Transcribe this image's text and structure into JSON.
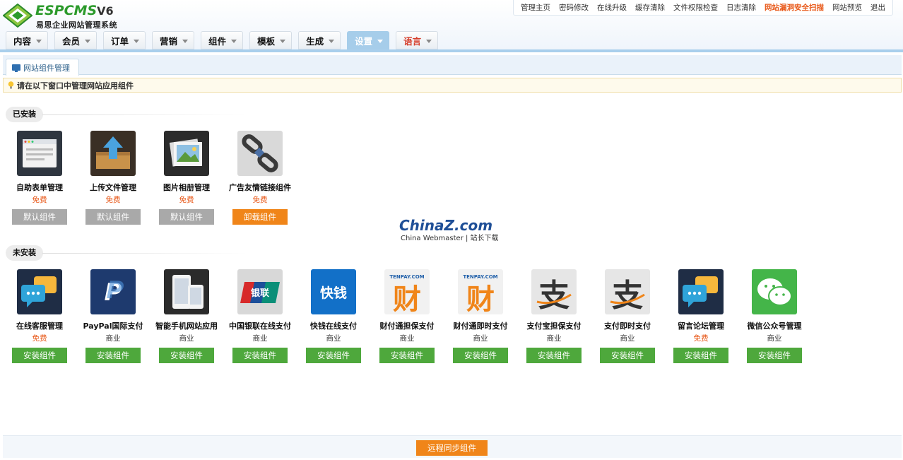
{
  "header": {
    "logo": {
      "brand": "ESPCMS",
      "version": "V6",
      "subtitle": "易思企业网站管理系统"
    },
    "top_links": [
      {
        "label": "管理主页",
        "highlight": false
      },
      {
        "label": "密码修改",
        "highlight": false
      },
      {
        "label": "在线升级",
        "highlight": false
      },
      {
        "label": "缓存清除",
        "highlight": false
      },
      {
        "label": "文件权限检查",
        "highlight": false
      },
      {
        "label": "日志清除",
        "highlight": false
      },
      {
        "label": "网站漏洞安全扫描",
        "highlight": true
      },
      {
        "label": "网站预览",
        "highlight": false
      },
      {
        "label": "退出",
        "highlight": false
      }
    ],
    "nav": [
      {
        "label": "内容",
        "active": false
      },
      {
        "label": "会员",
        "active": false
      },
      {
        "label": "订单",
        "active": false
      },
      {
        "label": "营销",
        "active": false
      },
      {
        "label": "组件",
        "active": false
      },
      {
        "label": "模板",
        "active": false
      },
      {
        "label": "生成",
        "active": false
      },
      {
        "label": "设置",
        "active": true
      },
      {
        "label": "语言",
        "active": false
      }
    ]
  },
  "tab": {
    "label": "网站组件管理"
  },
  "tip": "请在以下窗口中管理网站应用组件",
  "installed": {
    "title": "已安装",
    "items": [
      {
        "name": "自助表单管理",
        "price": "免费",
        "free": true,
        "button": "默认组件",
        "button_style": "gray",
        "icon": "form-icon"
      },
      {
        "name": "上传文件管理",
        "price": "免费",
        "free": true,
        "button": "默认组件",
        "button_style": "gray",
        "icon": "upload-icon"
      },
      {
        "name": "图片相册管理",
        "price": "免费",
        "free": true,
        "button": "默认组件",
        "button_style": "gray",
        "icon": "photo-album-icon"
      },
      {
        "name": "广告友情链接组件",
        "price": "免费",
        "free": true,
        "button": "卸载组件",
        "button_style": "orange",
        "icon": "chain-link-icon"
      }
    ]
  },
  "not_installed": {
    "title": "未安装",
    "items": [
      {
        "name": "在线客服管理",
        "price": "免费",
        "free": true,
        "button": "安装组件",
        "button_style": "green",
        "icon": "chat-bubbles-icon"
      },
      {
        "name": "PayPal国际支付",
        "price": "商业",
        "free": false,
        "button": "安装组件",
        "button_style": "green",
        "icon": "paypal-icon"
      },
      {
        "name": "智能手机网站应用",
        "price": "商业",
        "free": false,
        "button": "安装组件",
        "button_style": "green",
        "icon": "smartphone-icon"
      },
      {
        "name": "中国银联在线支付",
        "price": "商业",
        "free": false,
        "button": "安装组件",
        "button_style": "green",
        "icon": "unionpay-icon"
      },
      {
        "name": "快钱在线支付",
        "price": "商业",
        "free": false,
        "button": "安装组件",
        "button_style": "green",
        "icon": "99bill-icon"
      },
      {
        "name": "财付通担保支付",
        "price": "商业",
        "free": false,
        "button": "安装组件",
        "button_style": "green",
        "icon": "tenpay-icon"
      },
      {
        "name": "财付通即时支付",
        "price": "商业",
        "free": false,
        "button": "安装组件",
        "button_style": "green",
        "icon": "tenpay-icon"
      },
      {
        "name": "支付宝担保支付",
        "price": "商业",
        "free": false,
        "button": "安装组件",
        "button_style": "green",
        "icon": "alipay-icon"
      },
      {
        "name": "支付即时支付",
        "price": "商业",
        "free": false,
        "button": "安装组件",
        "button_style": "green",
        "icon": "alipay-icon"
      },
      {
        "name": "留言论坛管理",
        "price": "免费",
        "free": true,
        "button": "安装组件",
        "button_style": "green",
        "icon": "chat-bubbles-icon"
      },
      {
        "name": "微信公众号管理",
        "price": "商业",
        "free": false,
        "button": "安装组件",
        "button_style": "green",
        "icon": "wechat-icon"
      }
    ]
  },
  "watermark": {
    "main": "ChinaZ.com",
    "sub": "China Webmaster | 站长下载"
  },
  "footer": {
    "sync_button": "远程同步组件"
  },
  "colors": {
    "accent_blue": "#a9cfec",
    "orange": "#f08519",
    "green": "#4ea83c",
    "gray": "#a9a9a9",
    "free_text": "#e8591a"
  }
}
